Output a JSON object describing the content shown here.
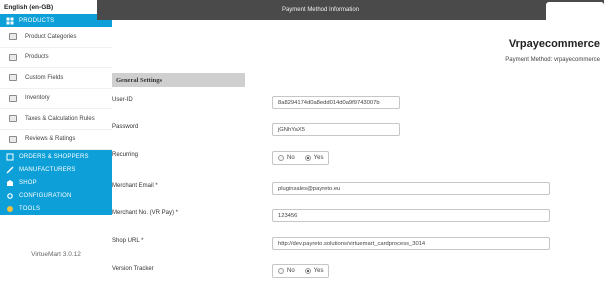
{
  "language": "English (en-GB)",
  "menu": {
    "products": "PRODUCTS",
    "sub_items": [
      {
        "label": "Product Categories",
        "icon": "folder-icon"
      },
      {
        "label": "Products",
        "icon": "products-icon"
      },
      {
        "label": "Custom Fields",
        "icon": "custom-fields-icon"
      },
      {
        "label": "Inventory",
        "icon": "inventory-icon"
      },
      {
        "label": "Taxes & Calculation Rules",
        "icon": "taxes-icon"
      },
      {
        "label": "Reviews & Ratings",
        "icon": "reviews-icon"
      }
    ],
    "orders": "ORDERS & SHOPPERS",
    "manufacturers": "MANUFACTURERS",
    "shop": "SHOP",
    "configuration": "CONFIGURATION",
    "tools": "TOOLS"
  },
  "version": "VirtueMart 3.0.12",
  "header": {
    "title": "Payment Method Information"
  },
  "plugin": {
    "name": "Vrpayecommerce",
    "subtitle": "Payment Method: vrpayecommerce"
  },
  "section_title": "General Settings",
  "fields": {
    "user_id": {
      "label": "User-ID",
      "value": "8a8294174d0a8edd014d0a9f9743007b"
    },
    "password": {
      "label": "Password",
      "value": "jGNhYaX5"
    },
    "recurring": {
      "label": "Recurring",
      "no": "No",
      "yes": "Yes",
      "selected": "Yes"
    },
    "merchant_email": {
      "label": "Merchant Email *",
      "value": "pluginsales@payreto.eu"
    },
    "merchant_no": {
      "label": "Merchant No. (VR Pay) *",
      "value": "123456"
    },
    "shop_url": {
      "label": "Shop URL *",
      "value": "http://dev.payreto.solutions/virtuemart_cardprocess_3014"
    },
    "version_tracker": {
      "label": "Version Tracker",
      "no": "No",
      "yes": "Yes",
      "selected": "Yes"
    }
  },
  "colors": {
    "menu_blue": "#0c9fd8",
    "header_dark": "#4a4a4a"
  }
}
